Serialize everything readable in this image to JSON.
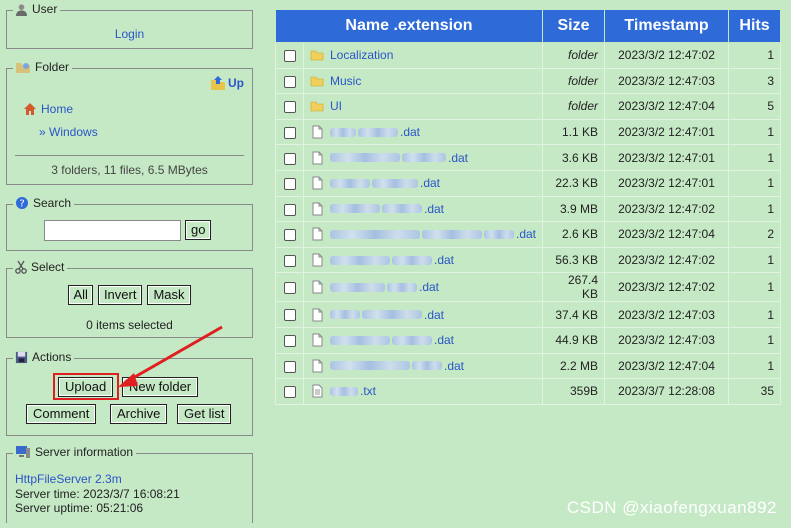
{
  "user": {
    "legend": "User",
    "login_label": "Login"
  },
  "folder": {
    "legend": "Folder",
    "up_label": "Up",
    "home_label": "Home",
    "current_label": "» Windows",
    "summary": "3 folders, 11 files, 6.5 MBytes"
  },
  "search": {
    "legend": "Search",
    "placeholder": "",
    "go_label": "go"
  },
  "select": {
    "legend": "Select",
    "all_label": "All",
    "invert_label": "Invert",
    "mask_label": "Mask",
    "status": "0 items selected"
  },
  "actions": {
    "legend": "Actions",
    "upload_label": "Upload",
    "new_folder_label": "New folder",
    "comment_label": "Comment",
    "archive_label": "Archive",
    "get_list_label": "Get list"
  },
  "server": {
    "legend": "Server information",
    "link": "HttpFileServer 2.3m",
    "time": "Server time: 2023/3/7 16:08:21",
    "uptime": "Server uptime: 05:21:06"
  },
  "table": {
    "headers": {
      "name": "Name .extension",
      "size": "Size",
      "timestamp": "Timestamp",
      "hits": "Hits"
    },
    "rows": [
      {
        "type": "folder",
        "name": "Localization",
        "size": "folder",
        "timestamp": "2023/3/2 12:47:02",
        "hits": "1"
      },
      {
        "type": "folder",
        "name": "Music",
        "size": "folder",
        "timestamp": "2023/3/2 12:47:03",
        "hits": "3"
      },
      {
        "type": "folder",
        "name": "UI",
        "size": "folder",
        "timestamp": "2023/3/2 12:47:04",
        "hits": "5"
      },
      {
        "type": "file",
        "name": ".dat",
        "size": "1.1 KB",
        "timestamp": "2023/3/2 12:47:01",
        "hits": "1"
      },
      {
        "type": "file",
        "name": ".dat",
        "size": "3.6 KB",
        "timestamp": "2023/3/2 12:47:01",
        "hits": "1"
      },
      {
        "type": "file",
        "name": ".dat",
        "size": "22.3 KB",
        "timestamp": "2023/3/2 12:47:01",
        "hits": "1"
      },
      {
        "type": "file",
        "name": ".dat",
        "size": "3.9 MB",
        "timestamp": "2023/3/2 12:47:02",
        "hits": "1"
      },
      {
        "type": "file",
        "name": ".dat",
        "size": "2.6 KB",
        "timestamp": "2023/3/2 12:47:04",
        "hits": "2"
      },
      {
        "type": "file",
        "name": ".dat",
        "size": "56.3 KB",
        "timestamp": "2023/3/2 12:47:02",
        "hits": "1"
      },
      {
        "type": "file",
        "name": ".dat",
        "size": "267.4 KB",
        "timestamp": "2023/3/2 12:47:02",
        "hits": "1"
      },
      {
        "type": "file",
        "name": ".dat",
        "size": "37.4 KB",
        "timestamp": "2023/3/2 12:47:03",
        "hits": "1"
      },
      {
        "type": "file",
        "name": ".dat",
        "size": "44.9 KB",
        "timestamp": "2023/3/2 12:47:03",
        "hits": "1"
      },
      {
        "type": "file",
        "name": ".dat",
        "size": "2.2 MB",
        "timestamp": "2023/3/2 12:47:04",
        "hits": "1"
      },
      {
        "type": "text",
        "name": ".txt",
        "size": "359B",
        "timestamp": "2023/3/7 12:28:08",
        "hits": "35"
      }
    ]
  },
  "watermark": "CSDN @xiaofengxuan892",
  "colors": {
    "background": "#c5e8c5",
    "header": "#2e6ad8",
    "link": "#2b55c9",
    "annotation": "#e02020"
  }
}
